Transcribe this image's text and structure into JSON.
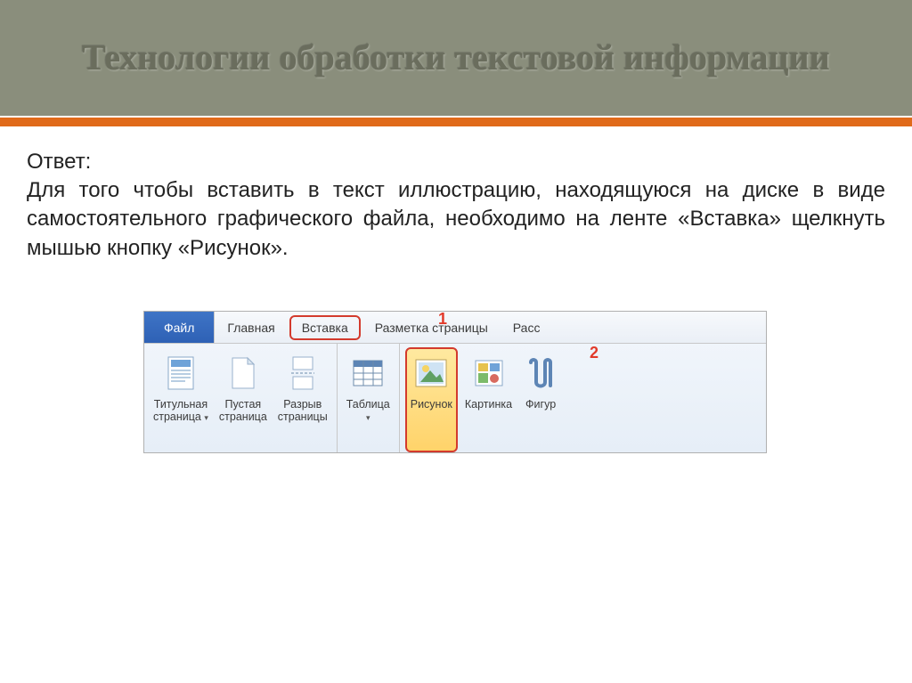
{
  "slide": {
    "title": "Технологии обработки текстовой информации",
    "answer_label": "Ответ:",
    "answer_text": "Для того чтобы вставить в текст иллюстрацию, находящуюся на диске в виде самостоятельного графического файла, необходимо на ленте «Вставка» щелкнуть мышью кнопку «Рисунок»."
  },
  "ribbon": {
    "tabs": {
      "file": "Файл",
      "home": "Главная",
      "insert": "Вставка",
      "layout": "Разметка страницы",
      "mailings": "Расс"
    },
    "annotations": {
      "one": "1",
      "two": "2"
    },
    "items": {
      "cover_page": {
        "l1": "Титульная",
        "l2": "страница"
      },
      "blank_page": {
        "l1": "Пустая",
        "l2": "страница"
      },
      "page_break": {
        "l1": "Разрыв",
        "l2": "страницы"
      },
      "table": "Таблица",
      "picture": "Рисунок",
      "clipart": "Картинка",
      "shapes": "Фигур"
    },
    "dropdown_glyph": "▾"
  },
  "colors": {
    "header_bg": "#8a8e7c",
    "accent_orange": "#e06a1a",
    "highlight_red": "#d33a2d",
    "file_tab": "#2e61b5"
  }
}
